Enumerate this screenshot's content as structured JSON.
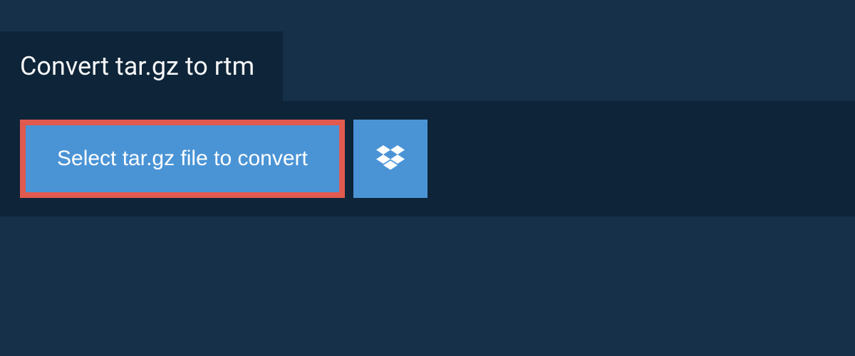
{
  "header": {
    "title": "Convert tar.gz to rtm"
  },
  "actions": {
    "select_label": "Select tar.gz file to convert",
    "dropbox_icon": "dropbox"
  },
  "colors": {
    "page_bg": "#16304a",
    "panel_bg": "#0e2438",
    "button_bg": "#4a94d6",
    "button_border": "#e05a4f",
    "text_light": "#ffffff"
  }
}
